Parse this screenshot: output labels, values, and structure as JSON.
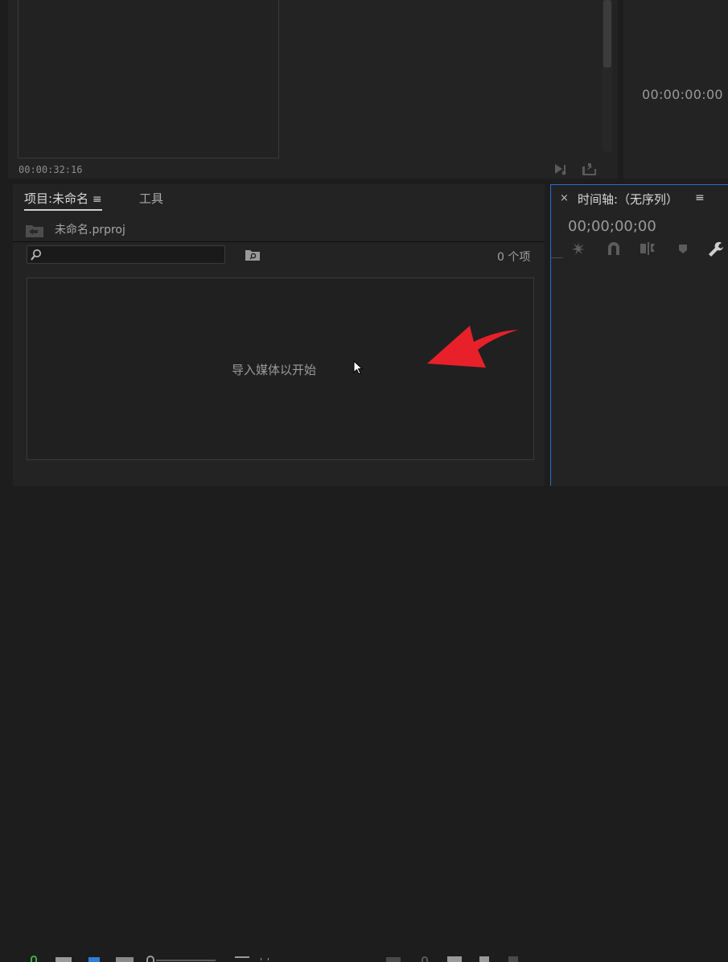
{
  "source_monitor": {
    "timecode": "00:00:32:16",
    "icons": [
      "play-audio-icon",
      "export-frame-icon"
    ]
  },
  "program_monitor": {
    "timecode": "00:00:00:00"
  },
  "project_panel": {
    "tab_project": "项目:未命名",
    "tab_menu_glyph": "≡",
    "tab_tools": "工具",
    "project_file": "未命名.prproj",
    "search": {
      "value": "",
      "placeholder": ""
    },
    "item_count": "0 个项",
    "drop_hint": "导入媒体以开始"
  },
  "timeline_panel": {
    "close_glyph": "×",
    "title": "时间轴:（无序列）",
    "menu_glyph": "≡",
    "timecode": "00;00;00;00",
    "tools": [
      "snap-icon",
      "linked-selection-icon",
      "add-marker-icon",
      "marker-icon",
      "wrench-icon"
    ]
  },
  "colors": {
    "accent_blue": "#2d6bd0",
    "annotation_red": "#e8202a",
    "panel_bg": "#232323"
  }
}
